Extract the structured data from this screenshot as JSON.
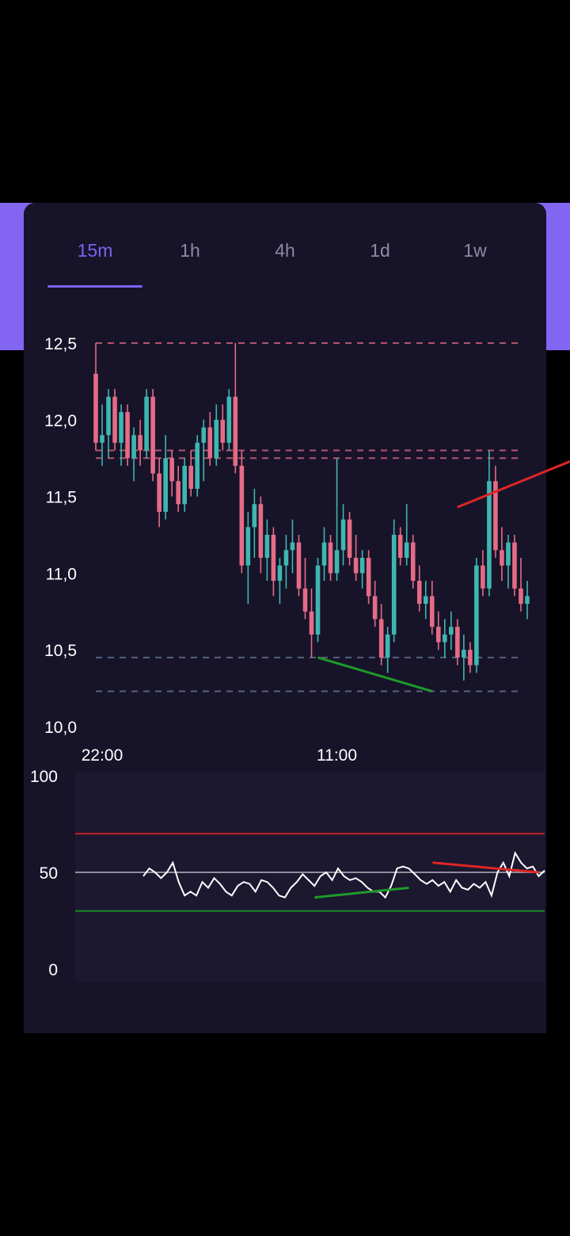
{
  "tabs": [
    {
      "label": "15m",
      "active": true
    },
    {
      "label": "1h",
      "active": false
    },
    {
      "label": "4h",
      "active": false
    },
    {
      "label": "1d",
      "active": false
    },
    {
      "label": "1w",
      "active": false
    }
  ],
  "colors": {
    "accent": "#7b63f0",
    "bull": "#3fb6b0",
    "bear": "#e56b86",
    "divergence_bull": "#1f9a2a",
    "divergence_bear": "#e02424",
    "rsi_line": "#ffffff"
  },
  "chart_data": [
    {
      "type": "candlestick",
      "y_ticks": [
        "12,5",
        "12,0",
        "11,5",
        "11,0",
        "10,5",
        "10,0"
      ],
      "x_ticks": [
        "22:00",
        "11:00"
      ],
      "ylim": [
        10.0,
        12.5
      ],
      "support_resistance_levels": [
        12.5,
        11.8,
        11.75,
        10.45,
        10.23
      ],
      "divergence_lines": [
        {
          "kind": "bullish",
          "from": [
            35,
            10.45
          ],
          "to": [
            53,
            10.23
          ]
        },
        {
          "kind": "bearish",
          "from": [
            57,
            11.43
          ],
          "to": [
            79,
            11.8
          ]
        }
      ],
      "series": [
        {
          "ohlc": [
            [
              12.3,
              12.5,
              11.8,
              11.85
            ],
            [
              11.85,
              12.1,
              11.7,
              11.9
            ],
            [
              11.9,
              12.2,
              11.75,
              12.15
            ],
            [
              12.15,
              12.2,
              11.8,
              11.85
            ],
            [
              11.85,
              12.1,
              11.7,
              12.05
            ],
            [
              12.05,
              12.1,
              11.7,
              11.75
            ],
            [
              11.75,
              11.95,
              11.6,
              11.9
            ],
            [
              11.9,
              12.0,
              11.7,
              11.8
            ],
            [
              11.8,
              12.2,
              11.75,
              12.15
            ],
            [
              12.15,
              12.2,
              11.6,
              11.65
            ],
            [
              11.65,
              11.75,
              11.3,
              11.4
            ],
            [
              11.4,
              11.9,
              11.35,
              11.75
            ],
            [
              11.75,
              11.8,
              11.5,
              11.6
            ],
            [
              11.6,
              11.7,
              11.4,
              11.45
            ],
            [
              11.45,
              11.75,
              11.4,
              11.7
            ],
            [
              11.7,
              11.8,
              11.5,
              11.55
            ],
            [
              11.55,
              11.9,
              11.5,
              11.85
            ],
            [
              11.85,
              12.0,
              11.6,
              11.95
            ],
            [
              11.95,
              12.05,
              11.7,
              11.75
            ],
            [
              11.75,
              12.1,
              11.7,
              12.0
            ],
            [
              12.0,
              12.1,
              11.8,
              11.85
            ],
            [
              11.85,
              12.2,
              11.8,
              12.15
            ],
            [
              12.15,
              12.5,
              11.65,
              11.7
            ],
            [
              11.7,
              11.8,
              11.0,
              11.05
            ],
            [
              11.05,
              11.4,
              10.8,
              11.3
            ],
            [
              11.3,
              11.55,
              11.1,
              11.45
            ],
            [
              11.45,
              11.5,
              11.0,
              11.1
            ],
            [
              11.1,
              11.35,
              10.95,
              11.25
            ],
            [
              11.25,
              11.3,
              10.85,
              10.95
            ],
            [
              10.95,
              11.1,
              10.8,
              11.05
            ],
            [
              11.05,
              11.25,
              10.9,
              11.15
            ],
            [
              11.15,
              11.35,
              11.0,
              11.2
            ],
            [
              11.2,
              11.25,
              10.85,
              10.9
            ],
            [
              10.9,
              11.1,
              10.7,
              10.75
            ],
            [
              10.75,
              10.9,
              10.45,
              10.6
            ],
            [
              10.6,
              11.1,
              10.55,
              11.05
            ],
            [
              11.05,
              11.3,
              10.95,
              11.2
            ],
            [
              11.2,
              11.25,
              10.95,
              11.0
            ],
            [
              11.0,
              11.75,
              10.95,
              11.15
            ],
            [
              11.15,
              11.45,
              11.05,
              11.35
            ],
            [
              11.35,
              11.4,
              11.05,
              11.1
            ],
            [
              11.1,
              11.25,
              10.95,
              11.0
            ],
            [
              11.0,
              11.15,
              10.9,
              11.1
            ],
            [
              11.1,
              11.15,
              10.8,
              10.85
            ],
            [
              10.85,
              10.95,
              10.65,
              10.7
            ],
            [
              10.7,
              10.8,
              10.4,
              10.45
            ],
            [
              10.45,
              10.65,
              10.35,
              10.6
            ],
            [
              10.6,
              11.35,
              10.55,
              11.25
            ],
            [
              11.25,
              11.3,
              11.05,
              11.1
            ],
            [
              11.1,
              11.45,
              11.05,
              11.2
            ],
            [
              11.2,
              11.25,
              10.9,
              10.95
            ],
            [
              10.95,
              11.05,
              10.75,
              10.8
            ],
            [
              10.8,
              10.95,
              10.7,
              10.85
            ],
            [
              10.85,
              10.95,
              10.6,
              10.65
            ],
            [
              10.65,
              10.75,
              10.5,
              10.55
            ],
            [
              10.55,
              10.7,
              10.45,
              10.6
            ],
            [
              10.6,
              10.75,
              10.5,
              10.65
            ],
            [
              10.65,
              10.7,
              10.4,
              10.45
            ],
            [
              10.45,
              10.6,
              10.3,
              10.5
            ],
            [
              10.5,
              10.55,
              10.35,
              10.4
            ],
            [
              10.4,
              11.1,
              10.35,
              11.05
            ],
            [
              11.05,
              11.15,
              10.85,
              10.9
            ],
            [
              10.9,
              11.8,
              10.85,
              11.6
            ],
            [
              11.6,
              11.7,
              11.1,
              11.15
            ],
            [
              11.15,
              11.3,
              10.95,
              11.05
            ],
            [
              11.05,
              11.25,
              10.9,
              11.2
            ],
            [
              11.2,
              11.25,
              10.85,
              10.9
            ],
            [
              10.9,
              11.1,
              10.75,
              10.8
            ],
            [
              10.8,
              10.95,
              10.7,
              10.85
            ]
          ]
        }
      ]
    },
    {
      "type": "line",
      "y_ticks": [
        "100",
        "50",
        "0"
      ],
      "ylim": [
        0,
        100
      ],
      "levels": [
        70,
        50,
        30
      ],
      "divergence_lines": [
        {
          "kind": "bullish",
          "from": [
            19,
            37
          ],
          "to": [
            35,
            42
          ]
        },
        {
          "kind": "bearish",
          "from": [
            39,
            55
          ],
          "to": [
            57,
            50
          ]
        }
      ],
      "series": [
        {
          "values": [
            48,
            52,
            50,
            47,
            50,
            55,
            45,
            38,
            40,
            38,
            45,
            42,
            47,
            44,
            40,
            38,
            43,
            45,
            44,
            40,
            46,
            45,
            42,
            38,
            37,
            42,
            45,
            49,
            46,
            43,
            48,
            50,
            46,
            52,
            48,
            46,
            47,
            45,
            42,
            40,
            40,
            37,
            43,
            52,
            53,
            52,
            49,
            46,
            44,
            46,
            43,
            45,
            40,
            46,
            42,
            41,
            44,
            42,
            45,
            38,
            50,
            55,
            48,
            60,
            55,
            52,
            53,
            48,
            51
          ]
        }
      ]
    }
  ]
}
